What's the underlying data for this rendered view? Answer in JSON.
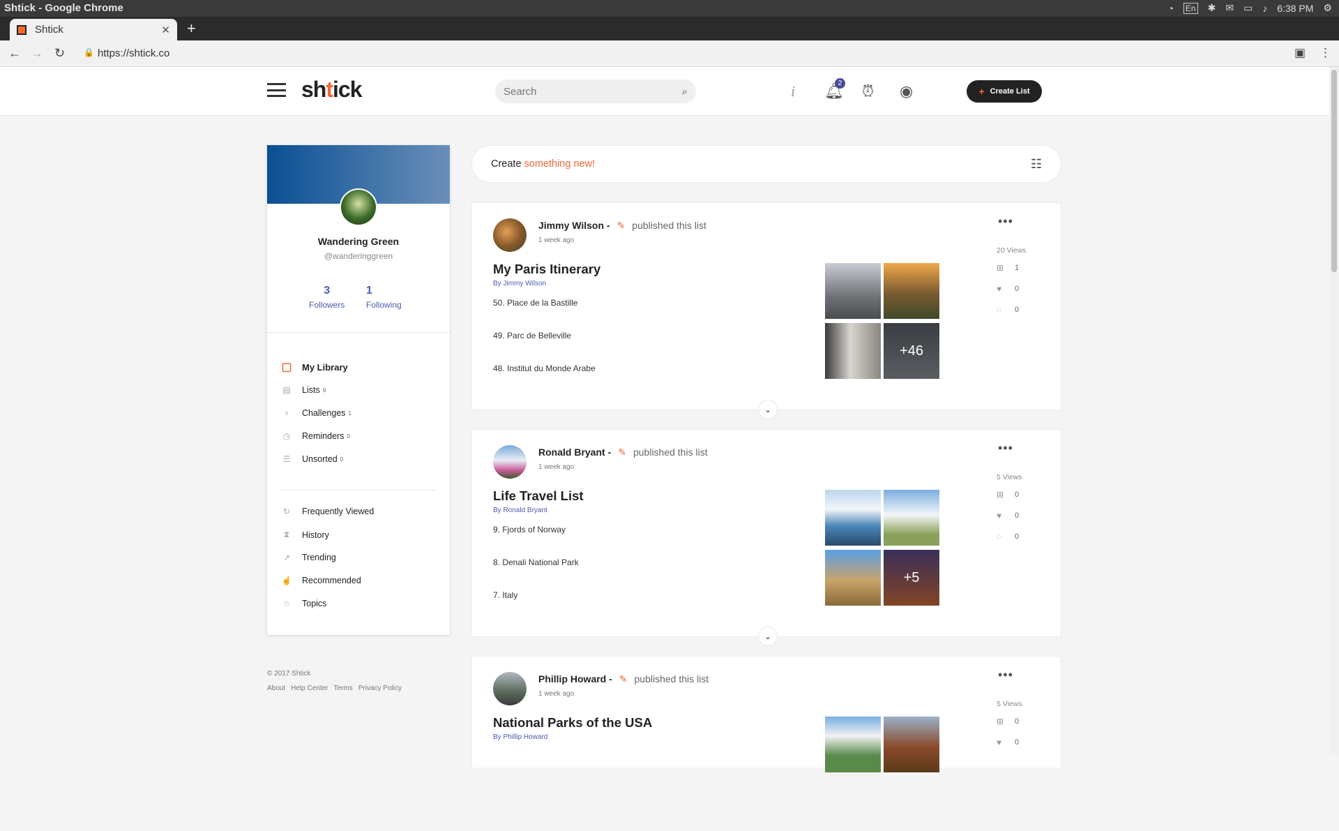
{
  "os": {
    "window_title": "Shtick - Google Chrome",
    "lang": "En",
    "time": "6:38 PM"
  },
  "browser": {
    "tab_title": "Shtick",
    "url": "https://shtick.co"
  },
  "header": {
    "logo_pre": "sh",
    "logo_acc": "t",
    "logo_post": "ick",
    "search_placeholder": "Search",
    "notification_count": "2",
    "create_list_label": "Create List",
    "icons": [
      "info-icon",
      "bell-icon",
      "alarm-icon",
      "user-icon"
    ]
  },
  "profile": {
    "name": "Wandering Green",
    "handle": "@wanderinggreen",
    "followers_count": "3",
    "followers_label": "Followers",
    "following_count": "1",
    "following_label": "Following",
    "library_title": "My Library",
    "library_items": [
      {
        "label": "Lists",
        "count": "9"
      },
      {
        "label": "Challenges",
        "count": "1"
      },
      {
        "label": "Reminders",
        "count": "0"
      },
      {
        "label": "Unsorted",
        "count": "0"
      }
    ],
    "discover_items": [
      {
        "label": "Frequently Viewed"
      },
      {
        "label": "History"
      },
      {
        "label": "Trending"
      },
      {
        "label": "Recommended"
      },
      {
        "label": "Topics"
      }
    ]
  },
  "footer": {
    "copyright": "© 2017 Shtick",
    "links": [
      "About",
      "Help Center",
      "Terms",
      "Privacy Policy"
    ]
  },
  "create_box": {
    "prefix": "Create",
    "accent": "something new!"
  },
  "feed": [
    {
      "author": "Jimmy Wilson -",
      "action": "published this list",
      "time": "1 week ago",
      "title": "My Paris Itinerary",
      "by": "By Jimmy Wilson",
      "items": [
        "50. Place de la Bastille",
        "49. Parc de Belleville",
        "48. Institut du Monde Arabe"
      ],
      "more": "+46",
      "views": "20 Views",
      "lists": "1",
      "likes": "0",
      "comments": "0"
    },
    {
      "author": "Ronald Bryant -",
      "action": "published this list",
      "time": "1 week ago",
      "title": "Life Travel List",
      "by": "By Ronald Bryant",
      "items": [
        "9. Fjords of Norway",
        "8. Denali National Park",
        "7. Italy"
      ],
      "more": "+5",
      "views": "5 Views",
      "lists": "0",
      "likes": "0",
      "comments": "0"
    },
    {
      "author": "Phillip Howard -",
      "action": "published this list",
      "time": "1 week ago",
      "title": "National Parks of the USA",
      "by": "By Phillip Howard",
      "items": [],
      "views": "5 Views",
      "lists": "0",
      "likes": "0"
    }
  ],
  "colors": {
    "accent": "#f06a35",
    "link": "#4a5bb0",
    "cover_start": "#0a4f94",
    "cover_end": "#6a8fb8"
  }
}
